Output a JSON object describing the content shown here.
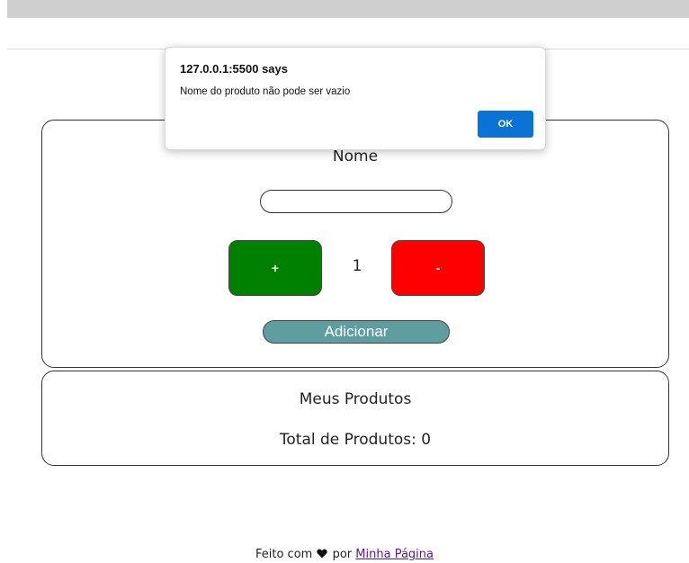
{
  "form": {
    "label": "Nome",
    "name_value": "",
    "plus_label": "+",
    "minus_label": "-",
    "quantity": "1",
    "add_label": "Adicionar"
  },
  "products": {
    "title": "Meus Produtos",
    "total_text": "Total de Produtos: 0"
  },
  "footer": {
    "prefix": "Feito com",
    "icon": "heart-icon",
    "middle": "por",
    "link_text": "Minha Página"
  },
  "dialog": {
    "title": "127.0.0.1:5500 says",
    "message": "Nome do produto não pode ser vazio",
    "ok_label": "OK"
  },
  "colors": {
    "plus_button": "#008000",
    "minus_button": "#ff0000",
    "add_button": "#5f9ea0",
    "dialog_ok": "#0b72d6",
    "link": "#551a8b"
  }
}
